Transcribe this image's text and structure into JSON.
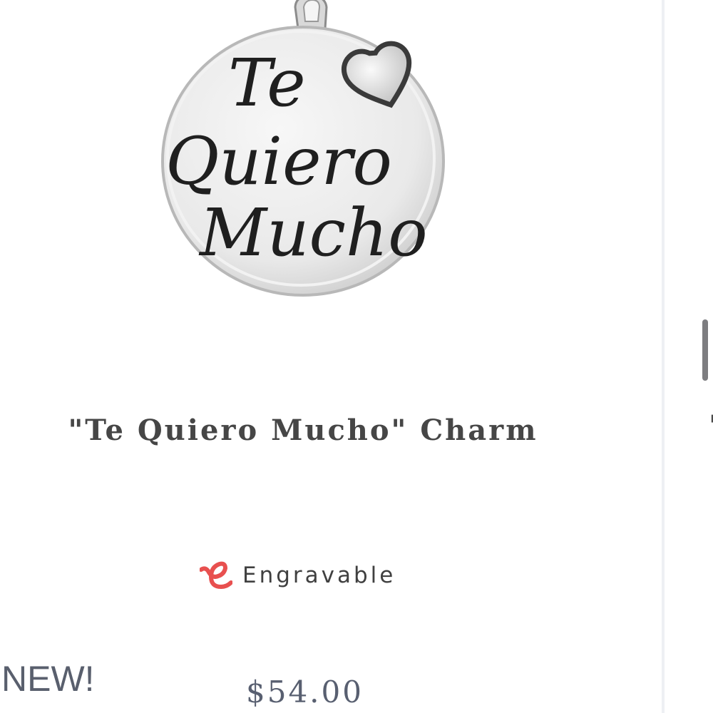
{
  "product": {
    "title": "\"Te Quiero Mucho\" Charm",
    "image_alt": "\"Te Quiero Mucho\" Charm",
    "image_text": {
      "line1": "Te",
      "line2": "Quiero",
      "line3": "Mucho"
    },
    "engravable_label": "Engravable",
    "badge": "NEW!",
    "price": "$54.00"
  },
  "next_card": {
    "title_glimpse": "\""
  },
  "colors": {
    "engrave_icon": "#e8504f",
    "title_text": "#464646",
    "price_text": "#585f70",
    "badge_text": "#595f6d",
    "scroll_thumb": "#7d7d80"
  },
  "icons": {
    "engrave": "engrave-e-icon"
  }
}
